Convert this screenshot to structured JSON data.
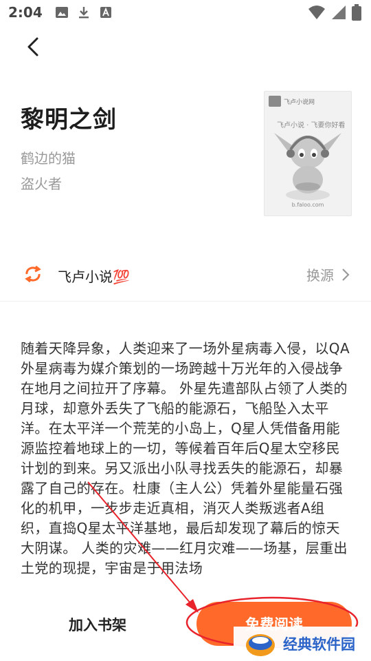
{
  "status_bar": {
    "time": "2:04"
  },
  "book": {
    "title": "黎明之剑",
    "author": "鹤边的猫",
    "category": "盗火者"
  },
  "cover": {
    "logo_text": "飞卢小说网",
    "slogan": "飞卢小说 · 飞要你好看",
    "footer": "b.faloo.com"
  },
  "source": {
    "name": "飞卢小说💯",
    "change_label": "换源"
  },
  "description": "随着天降异象，人类迎来了一场外星病毒入侵，以QA外星病毒为媒介策划的一场跨越十万光年的入侵战争在地月之间拉开了序幕。 外星先遣部队占领了人类的月球，却意外丢失了飞船的能源石，飞船坠入太平洋。在太平洋一个荒芜的小岛上，Q星人凭借备用能源监控着地球上的一切，等候着百年后Q星太空移民计划的到来。另又派出小队寻找丢失的能源石，却暴露了自己的存在。杜康（主人公）凭着外星能量石强化的机甲，一步步走近真相，消灭人类叛逃者A组织，直捣Q星太平洋基地，最后却发现了幕后的惊天大阴谋。 人类的灾难——红月灾难——场基，层重出土党的现提，宇宙是于用法场",
  "actions": {
    "add_shelf": "加入书架",
    "read_free": "免费阅读"
  },
  "watermark": {
    "text": "经典软件园"
  },
  "colors": {
    "accent": "#ff6a2a",
    "annotation": "#e8232b",
    "watermark": "#2b64c8"
  }
}
